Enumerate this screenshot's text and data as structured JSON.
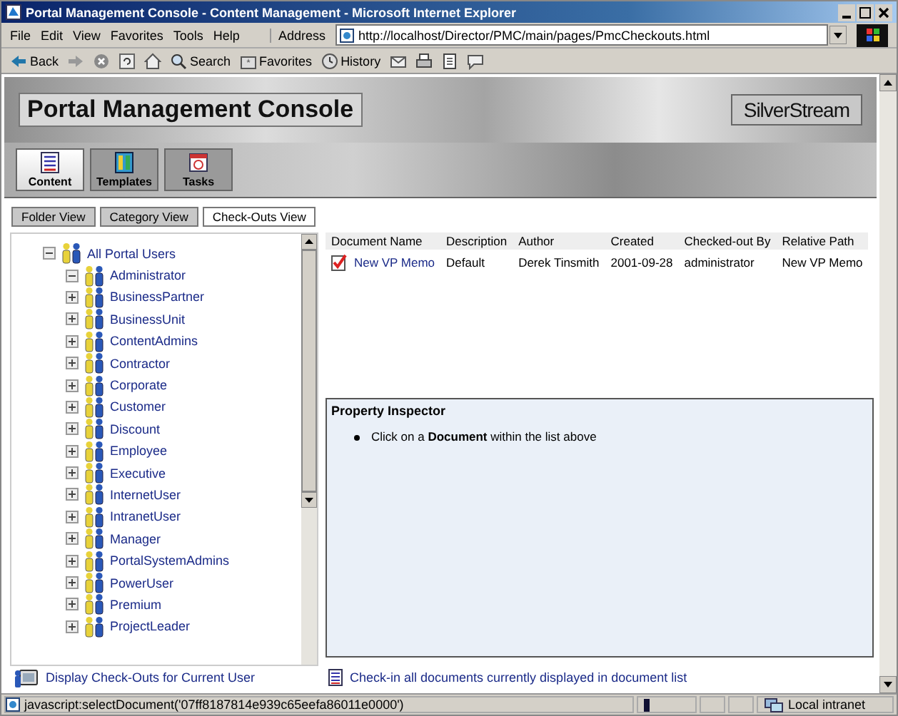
{
  "window": {
    "title": "Portal Management Console - Content Management - Microsoft Internet Explorer"
  },
  "menu": [
    "File",
    "Edit",
    "View",
    "Favorites",
    "Tools",
    "Help"
  ],
  "address": {
    "label": "Address",
    "value": "http://localhost/Director/PMC/main/pages/PmcCheckouts.html"
  },
  "toolbar": [
    {
      "kind": "back",
      "label": "Back"
    },
    {
      "kind": "forward"
    },
    {
      "kind": "stop"
    },
    {
      "kind": "refresh"
    },
    {
      "kind": "home"
    },
    {
      "kind": "search",
      "label": "Search"
    },
    {
      "kind": "favorites",
      "label": "Favorites"
    },
    {
      "kind": "history",
      "label": "History"
    },
    {
      "kind": "mail"
    },
    {
      "kind": "print"
    },
    {
      "kind": "edit"
    },
    {
      "kind": "discuss"
    }
  ],
  "header": {
    "title": "Portal Management Console",
    "logo": "SilverStream"
  },
  "tabs": [
    {
      "label": "Content",
      "kind": "content",
      "selected": true
    },
    {
      "label": "Templates",
      "kind": "templates",
      "selected": false
    },
    {
      "label": "Tasks",
      "kind": "tasks",
      "selected": false
    }
  ],
  "views": [
    {
      "label": "Folder View",
      "selected": false
    },
    {
      "label": "Category View",
      "selected": false
    },
    {
      "label": "Check-Outs View",
      "selected": true
    }
  ],
  "tree": {
    "label": "All Portal Users",
    "expanded": true,
    "children": [
      {
        "label": "Administrator",
        "expanded": true
      },
      {
        "label": "BusinessPartner",
        "expanded": false
      },
      {
        "label": "BusinessUnit",
        "expanded": false
      },
      {
        "label": "ContentAdmins",
        "expanded": false
      },
      {
        "label": "Contractor",
        "expanded": false
      },
      {
        "label": "Corporate",
        "expanded": false
      },
      {
        "label": "Customer",
        "expanded": false
      },
      {
        "label": "Discount",
        "expanded": false
      },
      {
        "label": "Employee",
        "expanded": false
      },
      {
        "label": "Executive",
        "expanded": false
      },
      {
        "label": "InternetUser",
        "expanded": false
      },
      {
        "label": "IntranetUser",
        "expanded": false
      },
      {
        "label": "Manager",
        "expanded": false
      },
      {
        "label": "PortalSystemAdmins",
        "expanded": false
      },
      {
        "label": "PowerUser",
        "expanded": false
      },
      {
        "label": "Premium",
        "expanded": false
      },
      {
        "label": "ProjectLeader",
        "expanded": false
      }
    ]
  },
  "table": {
    "columns": [
      "Document Name",
      "Description",
      "Author",
      "Created",
      "Checked-out By",
      "Relative Path"
    ],
    "rows": [
      [
        "New VP Memo",
        "Default",
        "Derek Tinsmith",
        "2001-09-28",
        "administrator",
        "New VP Memo"
      ]
    ]
  },
  "inspector": {
    "title": "Property Inspector",
    "items": [
      "Click on a **Document** within the list above"
    ]
  },
  "current_user_link": "Display Check-Outs for Current User",
  "checkin_link": "Check-in all documents currently displayed in document list",
  "status_bar": {
    "text": "javascript:selectDocument('07ff8187814e939c65eefa86011e0000')",
    "zone": "Local intranet"
  }
}
